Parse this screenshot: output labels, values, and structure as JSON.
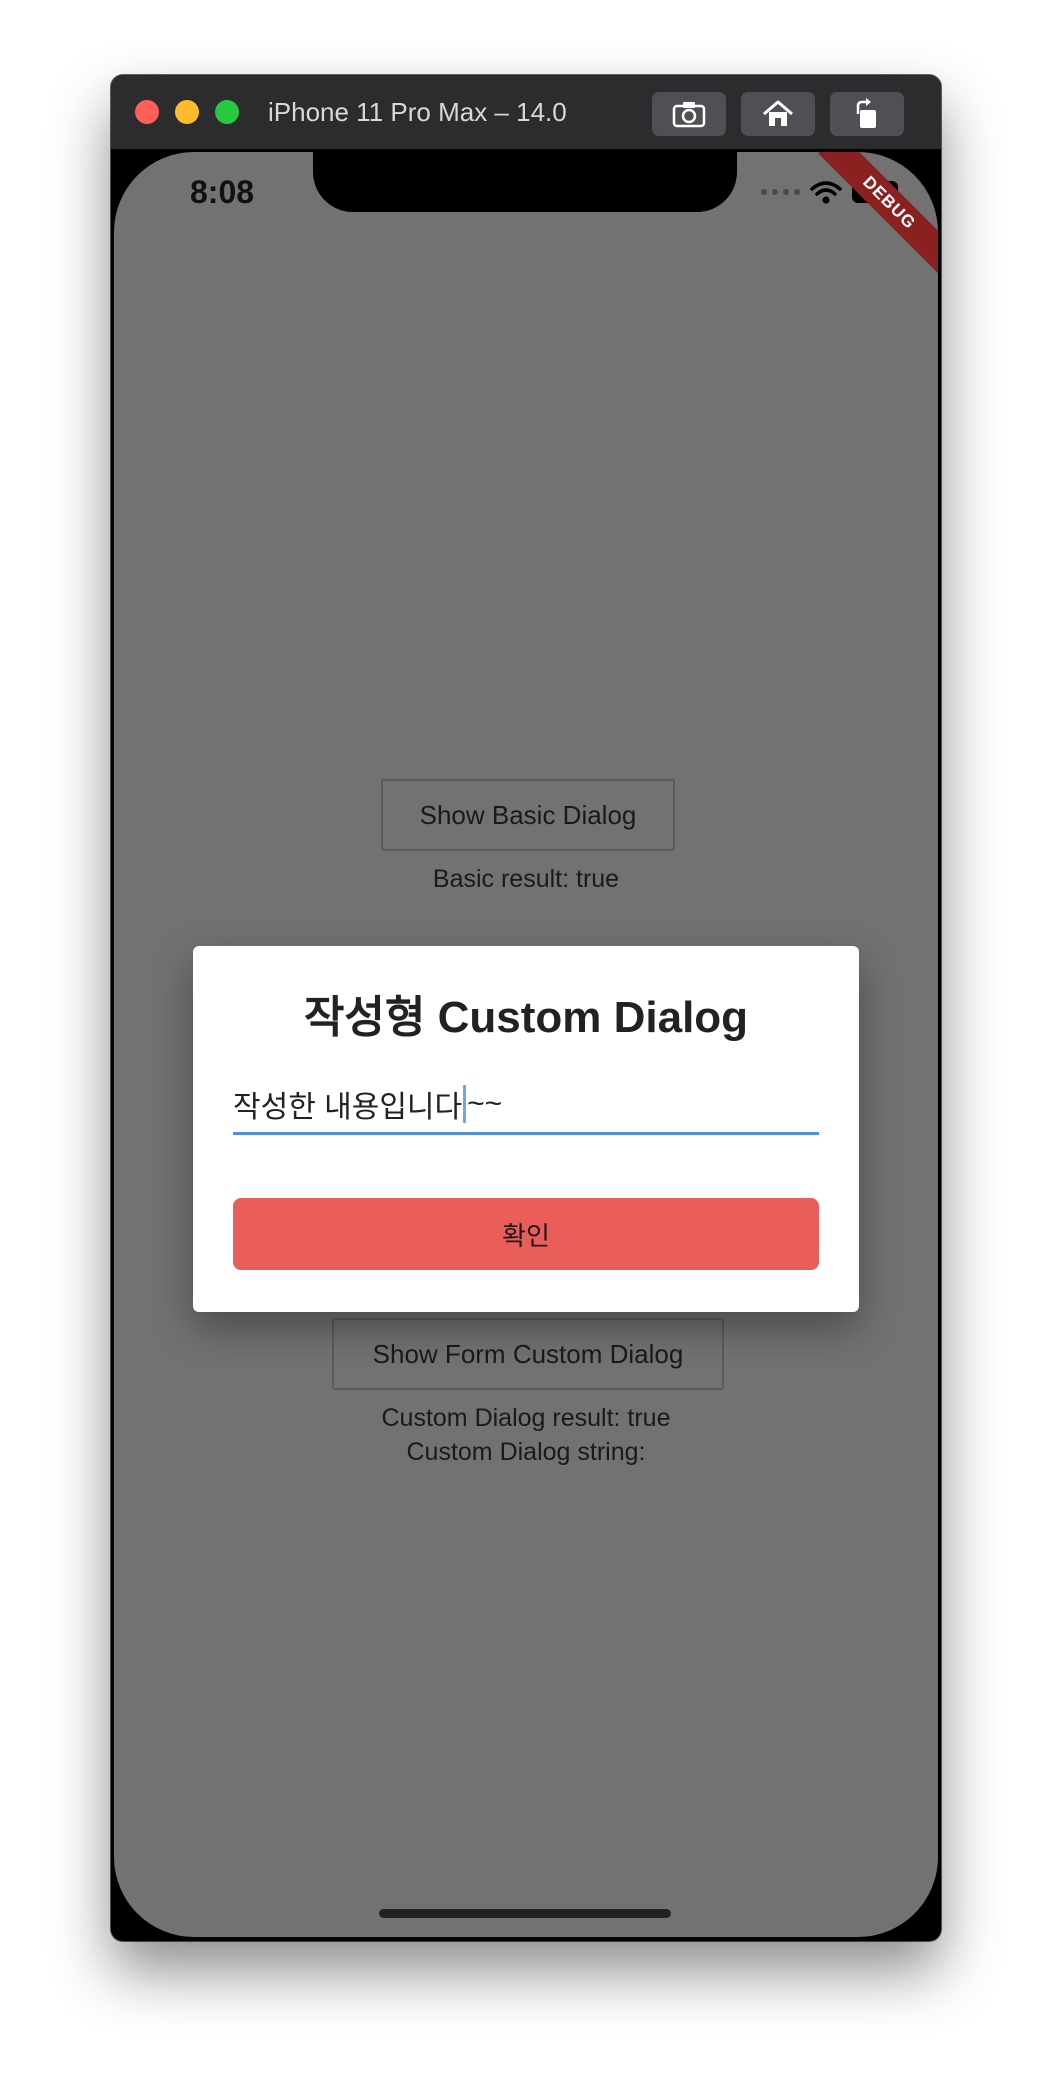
{
  "window": {
    "title": "iPhone 11 Pro Max – 14.0"
  },
  "status_bar": {
    "time": "8:08"
  },
  "debug_banner": "DEBUG",
  "main": {
    "basic_button_label": "Show Basic Dialog",
    "basic_result": "Basic result: true",
    "form_button_label": "Show Form Custom Dialog",
    "custom_result": "Custom Dialog result: true",
    "custom_string": "Custom Dialog string:"
  },
  "dialog": {
    "title": "작성형 Custom Dialog",
    "input_value_before_cursor": "작성한 내용입니다",
    "input_value_after_cursor": "~~",
    "confirm_label": "확인"
  },
  "colors": {
    "scrim": "#727272",
    "confirm_button": "#e95e59",
    "input_underline": "#4a8fe0",
    "debug_ribbon": "#8b2020"
  }
}
